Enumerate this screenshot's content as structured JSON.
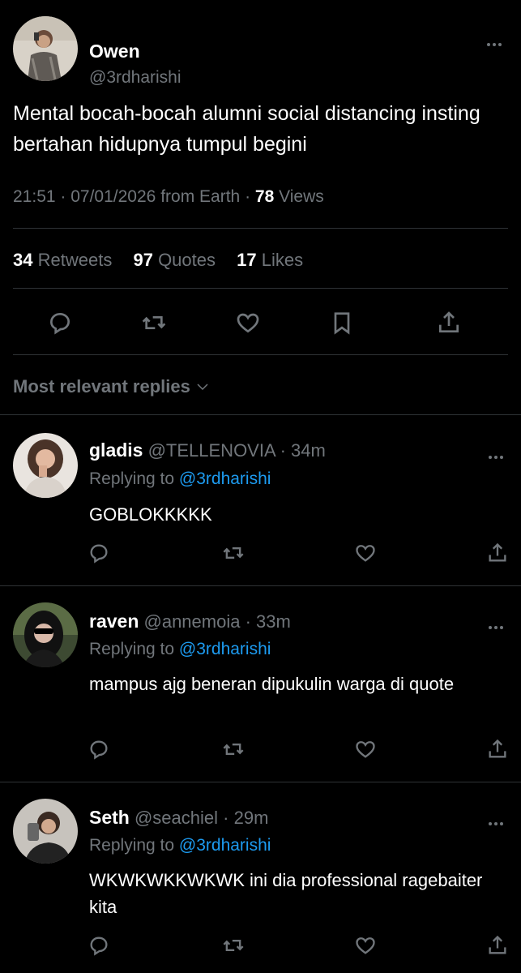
{
  "tweet": {
    "author_name": "Owen",
    "author_handle": "@3rdharishi",
    "text": "Mental bocah-bocah alumni social distancing insting bertahan hidupnya tumpul begini",
    "time": "21:51",
    "date": "07/01/2026",
    "source": "from Earth",
    "views_count": "78",
    "views_label": "Views",
    "retweets_count": "34",
    "retweets_label": "Retweets",
    "quotes_count": "97",
    "quotes_label": "Quotes",
    "likes_count": "17",
    "likes_label": "Likes"
  },
  "actions": [
    "reply-icon",
    "retweet-icon",
    "like-icon",
    "bookmark-icon",
    "share-icon"
  ],
  "replies_header": "Most relevant replies",
  "replies": [
    {
      "name": "gladis",
      "handle": "@TELLENOVIA",
      "time": "34m",
      "replying_label": "Replying to",
      "replying_to": "@3rdharishi",
      "text": "GOBLOKKKKK"
    },
    {
      "name": "raven",
      "handle": "@annemoia",
      "time": "33m",
      "replying_label": "Replying to",
      "replying_to": "@3rdharishi",
      "text": "mampus ajg beneran dipukulin warga di quote"
    },
    {
      "name": "Seth",
      "handle": "@seachiel",
      "time": "29m",
      "replying_label": "Replying to",
      "replying_to": "@3rdharishi",
      "text": "WKWKWKKWKWK ini dia professional ragebaiter kita"
    }
  ],
  "colors": {
    "background": "#000000",
    "text_primary": "#ffffff",
    "text_secondary": "#71767b",
    "link": "#1d9bf0",
    "divider": "#2f3336"
  }
}
